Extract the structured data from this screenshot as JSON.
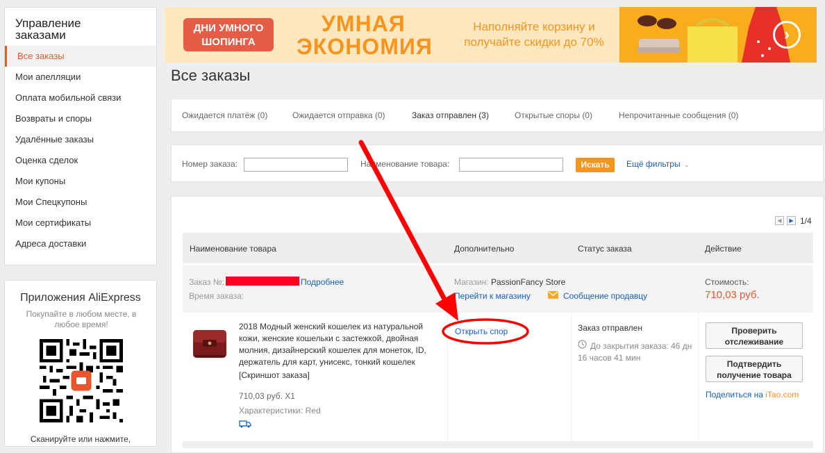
{
  "sidebar": {
    "title_line1": "Управление",
    "title_line2": "заказами",
    "items": [
      {
        "label": "Все заказы",
        "active": true
      },
      {
        "label": "Мои апелляции"
      },
      {
        "label": "Оплата мобильной связи"
      },
      {
        "label": "Возвраты и споры"
      },
      {
        "label": "Удалённые заказы"
      },
      {
        "label": "Оценка сделок"
      },
      {
        "label": "Мои купоны"
      },
      {
        "label": "Мои Спецкупоны"
      },
      {
        "label": "Мои сертификаты"
      },
      {
        "label": "Адреса доставки"
      }
    ]
  },
  "apps": {
    "title": "Приложения AliExpress",
    "subtitle": "Покупайте в любом месте, в любое время!",
    "scan": "Сканируйте или нажмите,"
  },
  "banner": {
    "badge_line1": "ДНИ УМНОГО",
    "badge_line2": "ШОПИНГА",
    "headline_line1": "УМНАЯ",
    "headline_line2": "ЭКОНОМИЯ",
    "promo": "Наполняйте корзину и получайте скидки до 70%",
    "arrow_icon": "chevron-right-circle-icon"
  },
  "page_title": "Все заказы",
  "tabs": [
    "Ожидается платёж (0)",
    "Ожидается отправка (0)",
    "Заказ отправлен (3)",
    "Открытые споры (0)",
    "Непрочитанные сообщения (0)"
  ],
  "filter": {
    "order_number_label": "Номер заказа:",
    "order_number_value": "",
    "product_name_label": "Наименование товара:",
    "product_name_value": "",
    "search_button": "Искать",
    "more_filters": "Ещё фильтры"
  },
  "pager": {
    "page": "1/4"
  },
  "table": {
    "headers": [
      "Наименование товара",
      "Дополнительно",
      "Статус заказа",
      "Действие"
    ]
  },
  "order": {
    "number_label": "Заказ №:",
    "details_link": "Подробнее",
    "time_label": "Время заказа:",
    "store_label": "Магазин:",
    "store_name": "PassionFancy Store",
    "store_link": "Перейти к магазину",
    "message_link": "Сообщение продавцу",
    "cost_label": "Стоимость:",
    "cost_value": "710,03 руб.",
    "product_title": "2018 Модный женский кошелек из натуральной кожи, женские кошельки с застежкой, двойная молния, дизайнерский кошелек для монеток, ID, держатель для карт, унисекс, тонкий кошелек",
    "snapshot": "[Скриншот заказа]",
    "price_qty": "710,03 руб. X1",
    "characteristics": "Характеристики: Red",
    "dispute_link": "Открыть спор",
    "status": "Заказ отправлен",
    "closing_info": "До закрытия заказа: 46 дн 16 часов 41 мин",
    "track_button_line1": "Проверить",
    "track_button_line2": "отслеживание",
    "confirm_button_line1": "Подтвердить",
    "confirm_button_line2": "получение товара",
    "share_text": "Поделиться на",
    "share_site": "iTao.com"
  },
  "colors": {
    "accent_orange": "#f7941d",
    "active_red": "#e8572b",
    "link_blue": "#1560bd",
    "annotation_red": "#ff0000"
  }
}
